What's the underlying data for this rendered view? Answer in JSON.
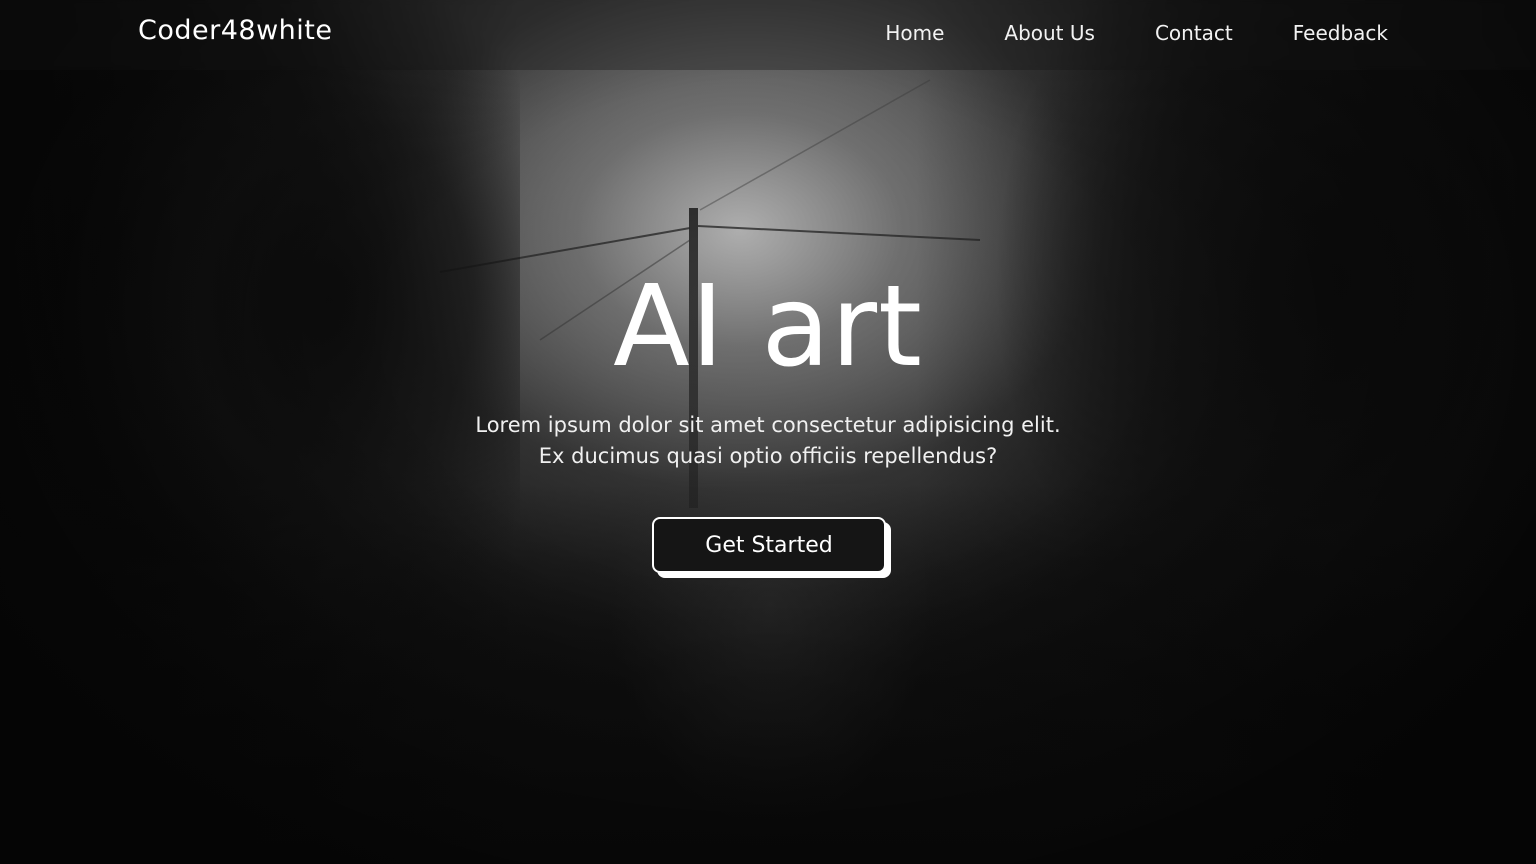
{
  "header": {
    "logo": "Coder48white",
    "nav": [
      {
        "label": "Home"
      },
      {
        "label": "About Us"
      },
      {
        "label": "Contact"
      },
      {
        "label": "Feedback"
      }
    ]
  },
  "hero": {
    "title": "AI art",
    "subtitle_line1": "Lorem ipsum dolor sit amet consectetur adipisicing elit.",
    "subtitle_line2": "Ex ducimus quasi optio officiis repellendus?",
    "cta_label": "Get Started"
  },
  "colors": {
    "text": "#ffffff",
    "button_bg": "#151515",
    "button_border": "#ffffff"
  }
}
